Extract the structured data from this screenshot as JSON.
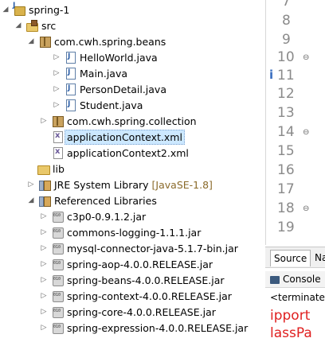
{
  "explorer": {
    "project": {
      "label": "spring-1",
      "icon": "java-project-icon"
    },
    "src": {
      "label": "src"
    },
    "pkg_beans": {
      "label": "com.cwh.spring.beans"
    },
    "java_files": [
      "HelloWorld.java",
      "Main.java",
      "PersonDetail.java",
      "Student.java"
    ],
    "pkg_collection": {
      "label": "com.cwh.spring.collection"
    },
    "xml_files": [
      "applicationContext.xml",
      "applicationContext2.xml"
    ],
    "lib": {
      "label": "lib"
    },
    "jre": {
      "label": "JRE System Library",
      "decoration": "[JavaSE-1.8]"
    },
    "ref_libs": {
      "label": "Referenced Libraries"
    },
    "jars": [
      "c3p0-0.9.1.2.jar",
      "commons-logging-1.1.1.jar",
      "mysql-connector-java-5.1.7-bin.jar",
      "spring-aop-4.0.0.RELEASE.jar",
      "spring-beans-4.0.0.RELEASE.jar",
      "spring-context-4.0.0.RELEASE.jar",
      "spring-core-4.0.0.RELEASE.jar",
      "spring-expression-4.0.0.RELEASE.jar"
    ],
    "selected": "applicationContext.xml"
  },
  "editor": {
    "line_numbers": [
      "7",
      "8",
      "9",
      "10",
      "11",
      "12",
      "13",
      "14",
      "15",
      "16",
      "17",
      "18",
      "19"
    ],
    "fold_markers": [
      "10",
      "14",
      "18"
    ],
    "info_marker_line": "11",
    "info_marker_glyph": "i"
  },
  "bottom": {
    "tabs": [
      {
        "label": "Source",
        "active": true
      },
      {
        "label": "Na",
        "active": false
      }
    ],
    "console_title": "Console",
    "console_status": "<terminated",
    "console_lines": [
      "ipport",
      "lassPa"
    ]
  }
}
